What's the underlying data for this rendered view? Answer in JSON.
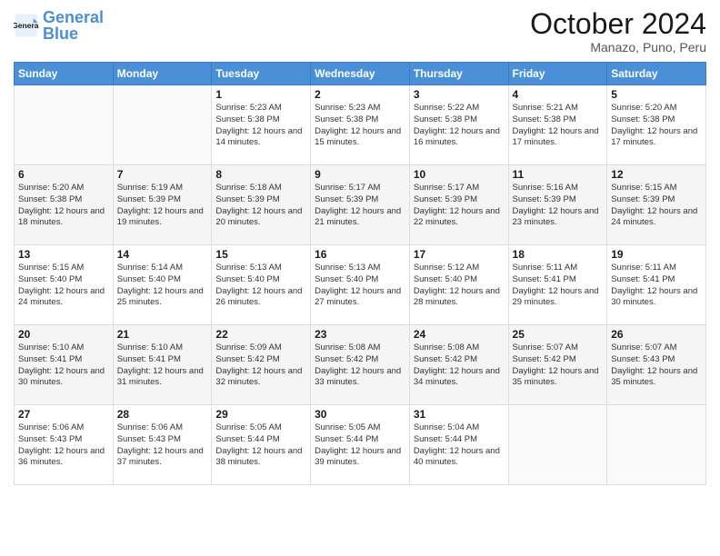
{
  "logo": {
    "line1": "General",
    "line2": "Blue"
  },
  "title": "October 2024",
  "subtitle": "Manazo, Puno, Peru",
  "days_header": [
    "Sunday",
    "Monday",
    "Tuesday",
    "Wednesday",
    "Thursday",
    "Friday",
    "Saturday"
  ],
  "weeks": [
    [
      {
        "day": "",
        "info": ""
      },
      {
        "day": "",
        "info": ""
      },
      {
        "day": "1",
        "info": "Sunrise: 5:23 AM\nSunset: 5:38 PM\nDaylight: 12 hours and 14 minutes."
      },
      {
        "day": "2",
        "info": "Sunrise: 5:23 AM\nSunset: 5:38 PM\nDaylight: 12 hours and 15 minutes."
      },
      {
        "day": "3",
        "info": "Sunrise: 5:22 AM\nSunset: 5:38 PM\nDaylight: 12 hours and 16 minutes."
      },
      {
        "day": "4",
        "info": "Sunrise: 5:21 AM\nSunset: 5:38 PM\nDaylight: 12 hours and 17 minutes."
      },
      {
        "day": "5",
        "info": "Sunrise: 5:20 AM\nSunset: 5:38 PM\nDaylight: 12 hours and 17 minutes."
      }
    ],
    [
      {
        "day": "6",
        "info": "Sunrise: 5:20 AM\nSunset: 5:38 PM\nDaylight: 12 hours and 18 minutes."
      },
      {
        "day": "7",
        "info": "Sunrise: 5:19 AM\nSunset: 5:39 PM\nDaylight: 12 hours and 19 minutes."
      },
      {
        "day": "8",
        "info": "Sunrise: 5:18 AM\nSunset: 5:39 PM\nDaylight: 12 hours and 20 minutes."
      },
      {
        "day": "9",
        "info": "Sunrise: 5:17 AM\nSunset: 5:39 PM\nDaylight: 12 hours and 21 minutes."
      },
      {
        "day": "10",
        "info": "Sunrise: 5:17 AM\nSunset: 5:39 PM\nDaylight: 12 hours and 22 minutes."
      },
      {
        "day": "11",
        "info": "Sunrise: 5:16 AM\nSunset: 5:39 PM\nDaylight: 12 hours and 23 minutes."
      },
      {
        "day": "12",
        "info": "Sunrise: 5:15 AM\nSunset: 5:39 PM\nDaylight: 12 hours and 24 minutes."
      }
    ],
    [
      {
        "day": "13",
        "info": "Sunrise: 5:15 AM\nSunset: 5:40 PM\nDaylight: 12 hours and 24 minutes."
      },
      {
        "day": "14",
        "info": "Sunrise: 5:14 AM\nSunset: 5:40 PM\nDaylight: 12 hours and 25 minutes."
      },
      {
        "day": "15",
        "info": "Sunrise: 5:13 AM\nSunset: 5:40 PM\nDaylight: 12 hours and 26 minutes."
      },
      {
        "day": "16",
        "info": "Sunrise: 5:13 AM\nSunset: 5:40 PM\nDaylight: 12 hours and 27 minutes."
      },
      {
        "day": "17",
        "info": "Sunrise: 5:12 AM\nSunset: 5:40 PM\nDaylight: 12 hours and 28 minutes."
      },
      {
        "day": "18",
        "info": "Sunrise: 5:11 AM\nSunset: 5:41 PM\nDaylight: 12 hours and 29 minutes."
      },
      {
        "day": "19",
        "info": "Sunrise: 5:11 AM\nSunset: 5:41 PM\nDaylight: 12 hours and 30 minutes."
      }
    ],
    [
      {
        "day": "20",
        "info": "Sunrise: 5:10 AM\nSunset: 5:41 PM\nDaylight: 12 hours and 30 minutes."
      },
      {
        "day": "21",
        "info": "Sunrise: 5:10 AM\nSunset: 5:41 PM\nDaylight: 12 hours and 31 minutes."
      },
      {
        "day": "22",
        "info": "Sunrise: 5:09 AM\nSunset: 5:42 PM\nDaylight: 12 hours and 32 minutes."
      },
      {
        "day": "23",
        "info": "Sunrise: 5:08 AM\nSunset: 5:42 PM\nDaylight: 12 hours and 33 minutes."
      },
      {
        "day": "24",
        "info": "Sunrise: 5:08 AM\nSunset: 5:42 PM\nDaylight: 12 hours and 34 minutes."
      },
      {
        "day": "25",
        "info": "Sunrise: 5:07 AM\nSunset: 5:42 PM\nDaylight: 12 hours and 35 minutes."
      },
      {
        "day": "26",
        "info": "Sunrise: 5:07 AM\nSunset: 5:43 PM\nDaylight: 12 hours and 35 minutes."
      }
    ],
    [
      {
        "day": "27",
        "info": "Sunrise: 5:06 AM\nSunset: 5:43 PM\nDaylight: 12 hours and 36 minutes."
      },
      {
        "day": "28",
        "info": "Sunrise: 5:06 AM\nSunset: 5:43 PM\nDaylight: 12 hours and 37 minutes."
      },
      {
        "day": "29",
        "info": "Sunrise: 5:05 AM\nSunset: 5:44 PM\nDaylight: 12 hours and 38 minutes."
      },
      {
        "day": "30",
        "info": "Sunrise: 5:05 AM\nSunset: 5:44 PM\nDaylight: 12 hours and 39 minutes."
      },
      {
        "day": "31",
        "info": "Sunrise: 5:04 AM\nSunset: 5:44 PM\nDaylight: 12 hours and 40 minutes."
      },
      {
        "day": "",
        "info": ""
      },
      {
        "day": "",
        "info": ""
      }
    ]
  ]
}
